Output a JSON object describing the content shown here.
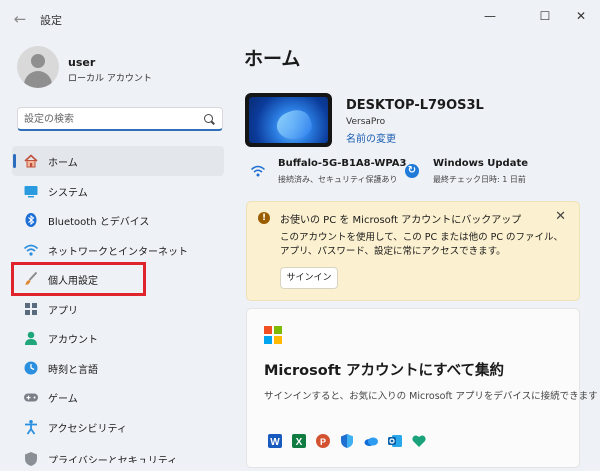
{
  "window": {
    "title": "設定",
    "back_glyph": "←",
    "minimize_glyph": "—",
    "maximize_glyph": "☐",
    "close_glyph": "✕"
  },
  "user": {
    "name": "user",
    "account_type": "ローカル アカウント"
  },
  "search": {
    "placeholder": "設定の検索"
  },
  "sidebar": {
    "items": [
      {
        "label": "ホーム",
        "icon": "home-icon",
        "selected": true
      },
      {
        "label": "システム",
        "icon": "system-icon"
      },
      {
        "label": "Bluetooth とデバイス",
        "icon": "bluetooth-icon"
      },
      {
        "label": "ネットワークとインターネット",
        "icon": "network-icon"
      },
      {
        "label": "個人用設定",
        "icon": "personalization-brush-icon"
      },
      {
        "label": "アプリ",
        "icon": "apps-icon"
      },
      {
        "label": "アカウント",
        "icon": "account-icon"
      },
      {
        "label": "時刻と言語",
        "icon": "time-language-icon"
      },
      {
        "label": "ゲーム",
        "icon": "gaming-icon"
      },
      {
        "label": "アクセシビリティ",
        "icon": "accessibility-icon"
      },
      {
        "label": "プライバシーとセキュリティ",
        "icon": "privacy-shield-icon"
      }
    ]
  },
  "main": {
    "title": "ホーム",
    "device": {
      "name": "DESKTOP-L79OS3L",
      "model": "VersaPro",
      "rename_link": "名前の変更"
    },
    "network": {
      "name": "Buffalo-5G-B1A8-WPA3",
      "status": "接続済み、セキュリティ保護あり"
    },
    "windows_update": {
      "name": "Windows Update",
      "status": "最終チェック日時: 1 日前"
    },
    "banner": {
      "title": "お使いの PC を Microsoft アカウントにバックアップ",
      "body": "このアカウントを使用して、この PC または他の PC のファイル、アプリ、パスワード、設定に常にアクセスできます。",
      "button": "サインイン",
      "close_glyph": "✕"
    },
    "ms_card": {
      "title": "Microsoft アカウントにすべて集約",
      "body": "サインインすると、お気に入りの Microsoft アプリをデバイスに接続できます",
      "apps": [
        "word-icon",
        "excel-icon",
        "powerpoint-icon",
        "defender-icon",
        "onedrive-icon",
        "outlook-icon",
        "family-icon"
      ]
    }
  },
  "colors": {
    "accent": "#2d6dc0",
    "highlight_box": "#e0242b",
    "banner_bg": "#fbf0cf"
  }
}
